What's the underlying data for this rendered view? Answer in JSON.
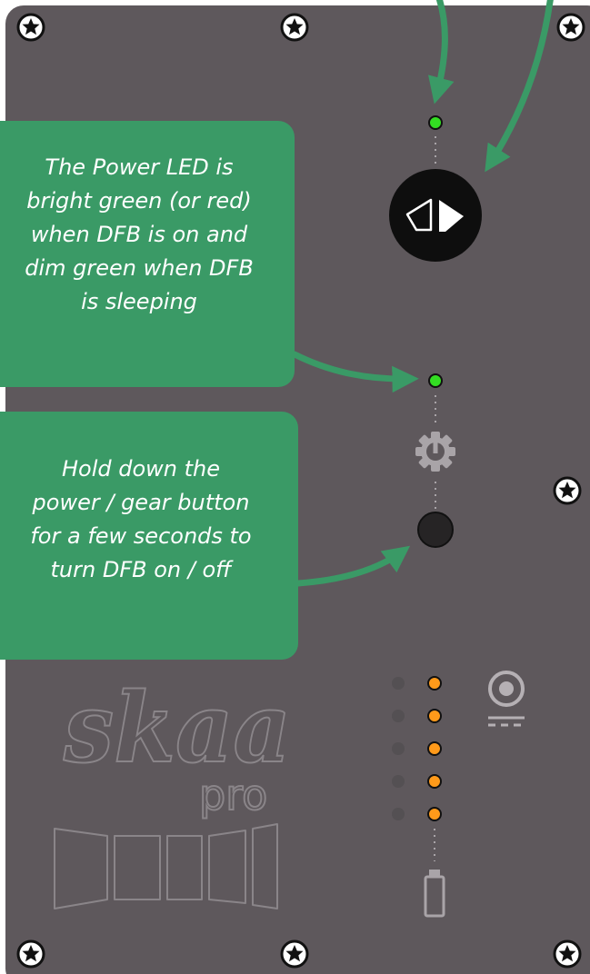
{
  "callouts": {
    "power_led": {
      "lines": [
        "The Power LED is",
        "bright green (or red)",
        "when DFB is on and",
        "dim green when DFB",
        "is sleeping"
      ]
    },
    "power_button": {
      "lines": [
        "Hold down the",
        "power / gear button",
        "for a few seconds to",
        "turn DFB on / off"
      ]
    }
  },
  "device": {
    "logo_text": "skaa",
    "logo_subtext": "pro",
    "colors": {
      "panel": "#5e585c",
      "led_green": "#33dd22",
      "led_orange": "#ff9a1a",
      "callout_bg": "#3a9a66",
      "arrow": "#3a9a66",
      "logo_outline": "#8a8589"
    },
    "battery_leds": {
      "lit": 5,
      "total": 5
    },
    "icons": [
      "screw-icon",
      "input-switch-icon",
      "power-gear-icon",
      "power-button",
      "dc-power-jack-icon",
      "battery-icon"
    ]
  }
}
